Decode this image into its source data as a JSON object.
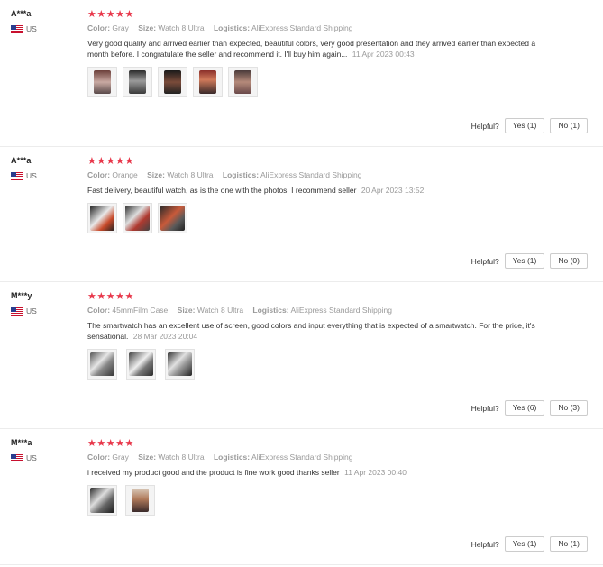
{
  "labels": {
    "color": "Color:",
    "size": "Size:",
    "logistics": "Logistics:",
    "helpful": "Helpful?",
    "stars": "★★★★★"
  },
  "reviews": [
    {
      "user": "A***a",
      "country": "US",
      "color": "Gray",
      "size": "Watch 8 Ultra",
      "logistics": "AliExpress Standard Shipping",
      "text": "Very good quality and arrived earlier than expected, beautiful colors, very good presentation and they arrived earlier than expected a month before. I congratulate the seller and recommend it. I'll buy him again...",
      "date": "11 Apr 2023 00:43",
      "photo_count": 5,
      "yes": "Yes (1)",
      "no": "No (1)"
    },
    {
      "user": "A***a",
      "country": "US",
      "color": "Orange",
      "size": "Watch 8 Ultra",
      "logistics": "AliExpress Standard Shipping",
      "text": "Fast delivery, beautiful watch, as is the one with the photos, I recommend seller",
      "date": "20 Apr 2023 13:52",
      "photo_count": 3,
      "yes": "Yes (1)",
      "no": "No (0)"
    },
    {
      "user": "M***y",
      "country": "US",
      "color": "45mmFilm Case",
      "size": "Watch 8 Ultra",
      "logistics": "AliExpress Standard Shipping",
      "text": "The smartwatch has an excellent use of screen, good colors and input everything that is expected of a smartwatch. For the price, it's sensational.",
      "date": "28 Mar 2023 20:04",
      "photo_count": 3,
      "yes": "Yes (6)",
      "no": "No (3)"
    },
    {
      "user": "M***a",
      "country": "US",
      "color": "Gray",
      "size": "Watch 8 Ultra",
      "logistics": "AliExpress Standard Shipping",
      "text": "i received my product good and the product is fine work good thanks seller",
      "date": "11 Apr 2023 00:40",
      "photo_count": 2,
      "yes": "Yes (1)",
      "no": "No (1)"
    }
  ]
}
